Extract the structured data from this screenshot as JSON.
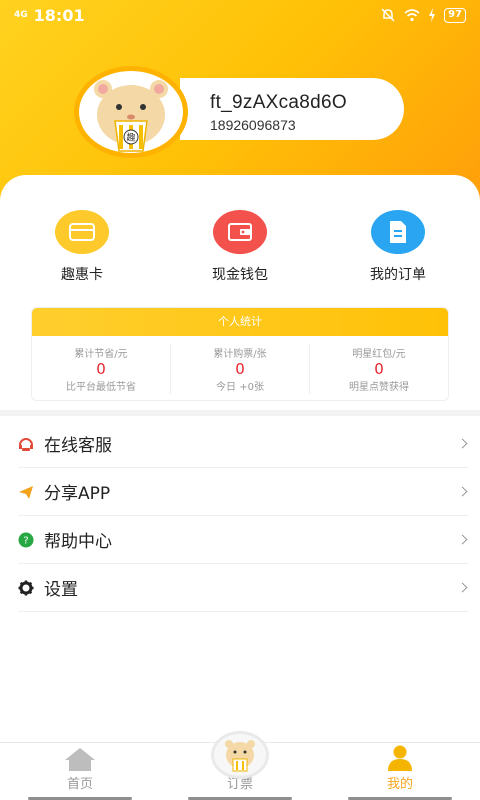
{
  "status_bar": {
    "network": "4G",
    "time": "18:01",
    "battery": "97"
  },
  "profile": {
    "avatar_icon": "hamster-popcorn-avatar",
    "avatar_badge_text": "趣",
    "username": "ft_9zAXca8d6O",
    "phone": "18926096873"
  },
  "quick_actions": [
    {
      "label": "趣惠卡",
      "icon": "card-icon",
      "color": "#fdc92b"
    },
    {
      "label": "现金钱包",
      "icon": "wallet-icon",
      "color": "#f2524b"
    },
    {
      "label": "我的订单",
      "icon": "order-icon",
      "color": "#29a5f1"
    }
  ],
  "stats": {
    "title": "个人统计",
    "items": [
      {
        "title": "累计节省/元",
        "value": "0",
        "sub": "比平台最低节省"
      },
      {
        "title": "累计购票/张",
        "value": "0",
        "sub": "今日 +0张"
      },
      {
        "title": "明星红包/元",
        "value": "0",
        "sub": "明星点赞获得"
      }
    ]
  },
  "menu": [
    {
      "label": "在线客服",
      "icon": "customer-service-icon",
      "color": "#e04b3a"
    },
    {
      "label": "分享APP",
      "icon": "share-icon",
      "color": "#f3a21a"
    },
    {
      "label": "帮助中心",
      "icon": "help-icon",
      "color": "#27a844"
    },
    {
      "label": "设置",
      "icon": "gear-icon",
      "color": "#222222"
    }
  ],
  "tabbar": {
    "items": [
      {
        "label": "首页",
        "icon": "home-icon",
        "active": false
      },
      {
        "label": "订票",
        "icon": "hamster-ticket-icon",
        "active": false
      },
      {
        "label": "我的",
        "icon": "user-icon",
        "active": true
      }
    ]
  },
  "colors": {
    "brand": "#ffc107",
    "accent": "#f5a623",
    "stat_value": "#e8232d"
  }
}
